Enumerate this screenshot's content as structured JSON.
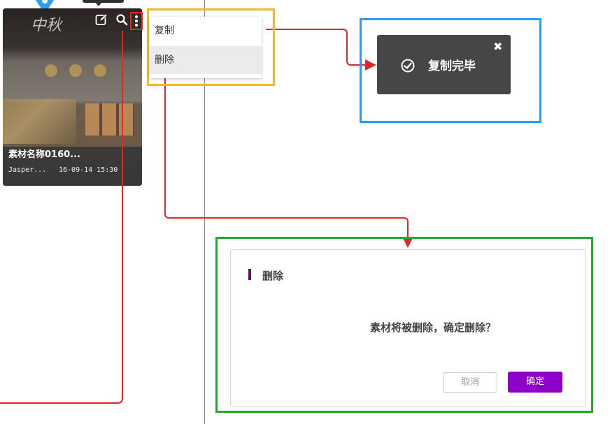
{
  "card": {
    "title": "素材名称0160...",
    "author": "Jasper...",
    "time": "16-09-14 15:30"
  },
  "menu": {
    "copy_label": "复制",
    "delete_label": "删除"
  },
  "toast": {
    "message": "复制完毕",
    "close_glyph": "✖"
  },
  "dialog": {
    "title": "删除",
    "message": "素材将被删除，确定删除？",
    "cancel_label": "取消",
    "confirm_label": "确定"
  },
  "icons": {
    "edit": "edit-icon",
    "search": "search-icon",
    "more": "more-vertical-icon",
    "check": "check-circle-icon",
    "close": "close-icon"
  },
  "colors": {
    "annotation_red": "#e3262a",
    "menu_highlight": "#f5b91f",
    "toast_highlight": "#2d9cf0",
    "dialog_highlight": "#22aa2a",
    "confirm_purple": "#8f00c8",
    "title_accent": "#5d1263"
  }
}
